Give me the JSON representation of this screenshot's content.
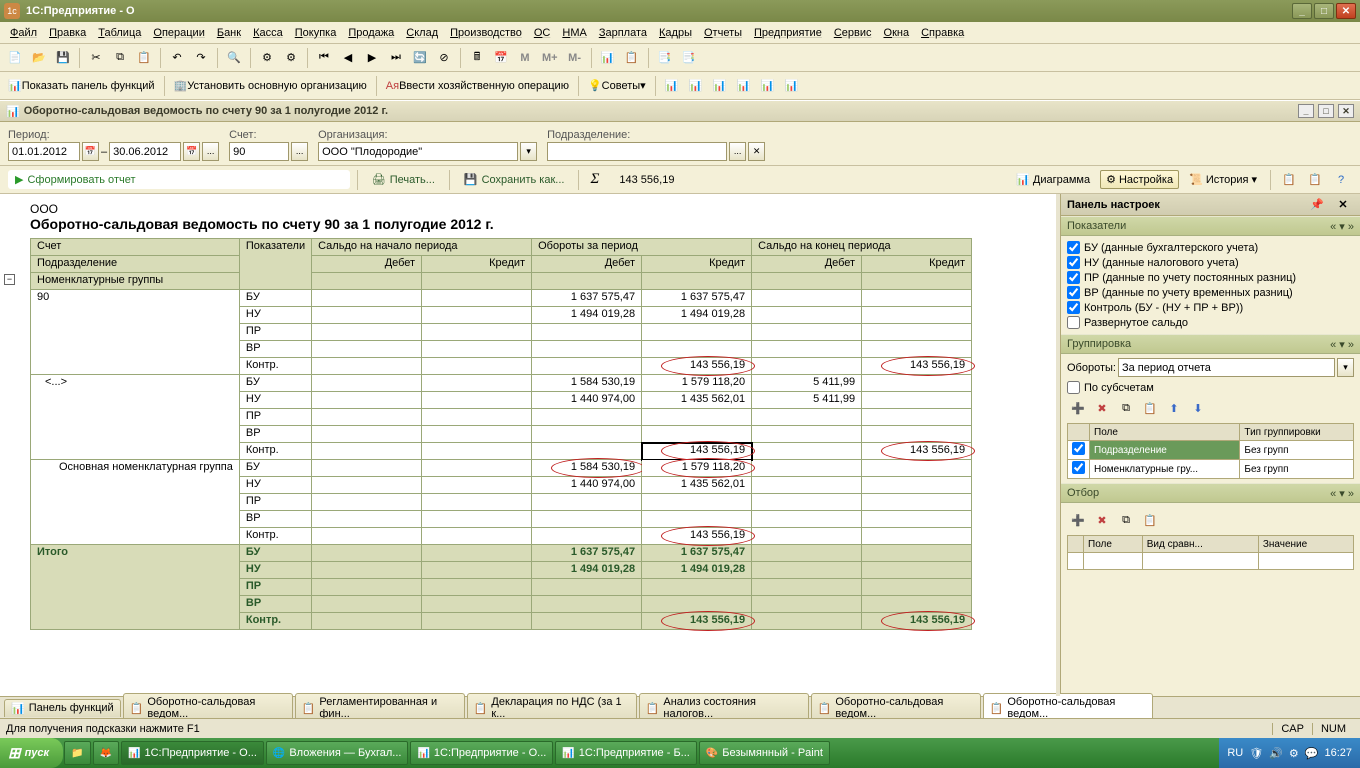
{
  "titlebar": {
    "app_title": "1С:Предприятие - О"
  },
  "menu": {
    "items": [
      "Файл",
      "Правка",
      "Таблица",
      "Операции",
      "Банк",
      "Касса",
      "Покупка",
      "Продажа",
      "Склад",
      "Производство",
      "ОС",
      "НМА",
      "Зарплата",
      "Кадры",
      "Отчеты",
      "Предприятие",
      "Сервис",
      "Окна",
      "Справка"
    ]
  },
  "toolbar1": {
    "m": "M",
    "mplus": "M+",
    "mminus": "M-"
  },
  "toolbar2": {
    "panel_func": "Показать панель функций",
    "set_org": "Установить основную организацию",
    "enter_op": "Ввести хозяйственную операцию",
    "tips": "Советы"
  },
  "doc": {
    "title": "Оборотно-сальдовая ведомость по счету 90 за 1 полугодие 2012 г."
  },
  "params": {
    "period_lbl": "Период:",
    "period_from": "01.01.2012",
    "period_to": "30.06.2012",
    "dash": "–",
    "account_lbl": "Счет:",
    "account": "90",
    "org_lbl": "Организация:",
    "org": "ООО \"Плодородие\"",
    "podr_lbl": "Подразделение:",
    "podr": ""
  },
  "actions": {
    "form": "Сформировать отчет",
    "print": "Печать...",
    "save": "Сохранить как...",
    "sigma_val": "143 556,19"
  },
  "report": {
    "company": "ООО",
    "title": "Оборотно-сальдовая ведомость по счету 90 за 1 полугодие 2012 г.",
    "hdr": {
      "account": "Счет",
      "subdiv": "Подразделение",
      "nomgroups": "Номенклатурные группы",
      "indic": "Показатели",
      "saldo_start": "Сальдо на начало периода",
      "turnover": "Обороты за период",
      "saldo_end": "Сальдо на конец периода",
      "debit": "Дебет",
      "credit": "Кредит"
    },
    "indicators": {
      "bu": "БУ",
      "nu": "НУ",
      "pr": "ПР",
      "vr": "ВР",
      "kontr": "Контр."
    },
    "acc_90": "90",
    "ellipsis": "<...>",
    "main_nom": "Основная номенклатурная группа",
    "itogo": "Итого",
    "vals": {
      "r1": {
        "td": "1 637 575,47",
        "tc": "1 637 575,47"
      },
      "r2": {
        "td": "1 494 019,28",
        "tc": "1 494 019,28"
      },
      "r5": {
        "tc": "143 556,19",
        "ec": "143 556,19"
      },
      "r6": {
        "td": "1 584 530,19",
        "tc": "1 579 118,20",
        "ed": "5 411,99"
      },
      "r7": {
        "td": "1 440 974,00",
        "tc": "1 435 562,01",
        "ed": "5 411,99"
      },
      "r10": {
        "tc": "143 556,19",
        "ec": "143 556,19"
      },
      "r11": {
        "td": "1 584 530,19",
        "tc": "1 579 118,20"
      },
      "r12": {
        "td": "1 440 974,00",
        "tc": "1 435 562,01"
      },
      "r15": {
        "tc": "143 556,19"
      },
      "t1": {
        "td": "1 637 575,47",
        "tc": "1 637 575,47"
      },
      "t2": {
        "td": "1 494 019,28",
        "tc": "1 494 019,28"
      },
      "t5": {
        "tc": "143 556,19",
        "ec": "143 556,19"
      }
    }
  },
  "rvtools": {
    "diagram": "Диаграмма",
    "settings": "Настройка",
    "history": "История"
  },
  "rpanel": {
    "title": "Панель настроек",
    "s1": {
      "title": "Показатели",
      "chk": {
        "bu": "БУ (данные бухгалтерского учета)",
        "nu": "НУ (данные налогового учета)",
        "pr": "ПР (данные по учету постоянных разниц)",
        "vr": "ВР (данные по учету временных разниц)",
        "kontr": "Контроль (БУ - (НУ + ПР + ВР))",
        "razv": "Развернутое сальдо"
      }
    },
    "s2": {
      "title": "Группировка",
      "obor_lbl": "Обороты:",
      "obor_val": "За период отчета",
      "subacc": "По субсчетам",
      "th1": "Поле",
      "th2": "Тип группировки",
      "r1c1": "Подразделение",
      "r1c2": "Без групп",
      "r2c1": "Номенклатурные гру...",
      "r2c2": "Без групп"
    },
    "s3": {
      "title": "Отбор",
      "th1": "Поле",
      "th2": "Вид сравн...",
      "th3": "Значение"
    }
  },
  "btabs": {
    "t1": "Панель функций",
    "t2": "Оборотно-сальдовая ведом...",
    "t3": "Регламентированная и фин...",
    "t4": "Декларация по НДС (за 1 к...",
    "t5": "Анализ состояния налогов...",
    "t6": "Оборотно-сальдовая ведом...",
    "t7": "Оборотно-сальдовая ведом..."
  },
  "status": {
    "hint": "Для получения подсказки нажмите F1",
    "cap": "CAP",
    "num": "NUM"
  },
  "taskbar": {
    "start": "пуск",
    "t1": "1С:Предприятие - О...",
    "t2": "Вложения — Бухгал...",
    "t3": "1С:Предприятие - О...",
    "t4": "1С:Предприятие - Б...",
    "t5": "Безымянный - Paint",
    "lang": "RU",
    "clock": "16:27"
  }
}
